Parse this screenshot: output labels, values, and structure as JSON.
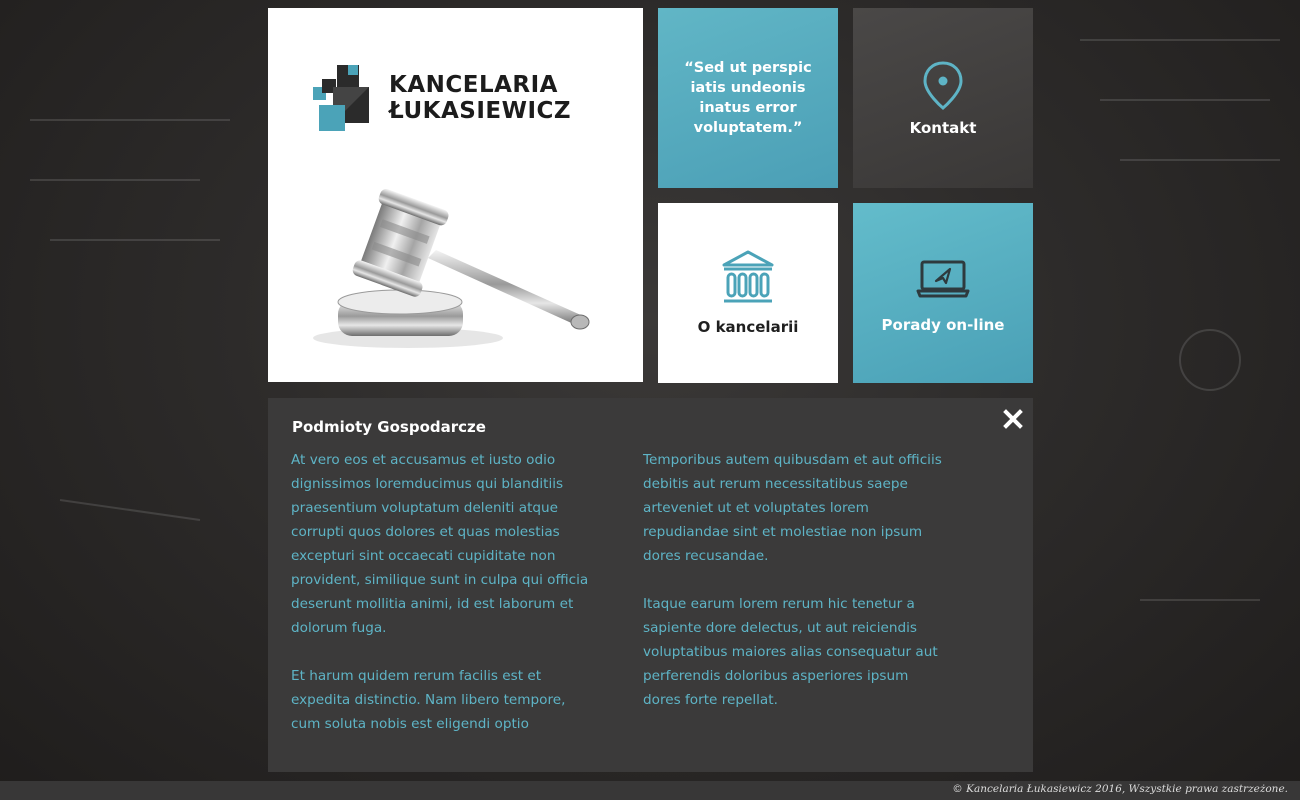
{
  "brand": {
    "line1": "KANCELARIA",
    "line2": "ŁUKASIEWICZ"
  },
  "tiles": {
    "quote": "“Sed ut perspic iatis undeonis inatus error voluptatem.”",
    "kontakt": {
      "label": "Kontakt",
      "icon": "map-pin-icon"
    },
    "about": {
      "label": "O kancelarii",
      "icon": "building-columns-icon"
    },
    "porady": {
      "label": "Porady on-line",
      "icon": "laptop-icon"
    }
  },
  "panel": {
    "title": "Podmioty Gospodarcze",
    "close_icon": "close-icon",
    "left_column": [
      "At vero eos et accusamus et iusto odio dignissimos loremducimus qui blanditiis praesentium voluptatum deleniti atque corrupti quos dolores et quas molestias excepturi sint occaecati cupiditate non provident, similique sunt in culpa qui officia deserunt mollitia animi, id est laborum et dolorum fuga.",
      "Et harum quidem rerum facilis est et expedita distinctio. Nam libero tempore, cum soluta nobis est eligendi optio"
    ],
    "right_column": [
      "Temporibus autem quibusdam et aut officiis debitis aut rerum necessitatibus saepe arteveniet ut et voluptates lorem repudiandae sint et molestiae non ipsum dores recusandae.",
      "Itaque earum lorem rerum hic tenetur a sapiente dore delectus, ut aut reiciendis voluptatibus maiores alias consequatur aut perferendis doloribus asperiores ipsum dores forte repellat."
    ]
  },
  "footer": {
    "copyright": "© Kancelaria Łukasiewicz 2016, Wszystkie prawa zastrzeżone."
  },
  "colors": {
    "accent": "#5eb4c6",
    "tile_teal": "#52a8bd",
    "tile_dark": "#403e3d",
    "panel_bg": "#3b3a3a"
  }
}
